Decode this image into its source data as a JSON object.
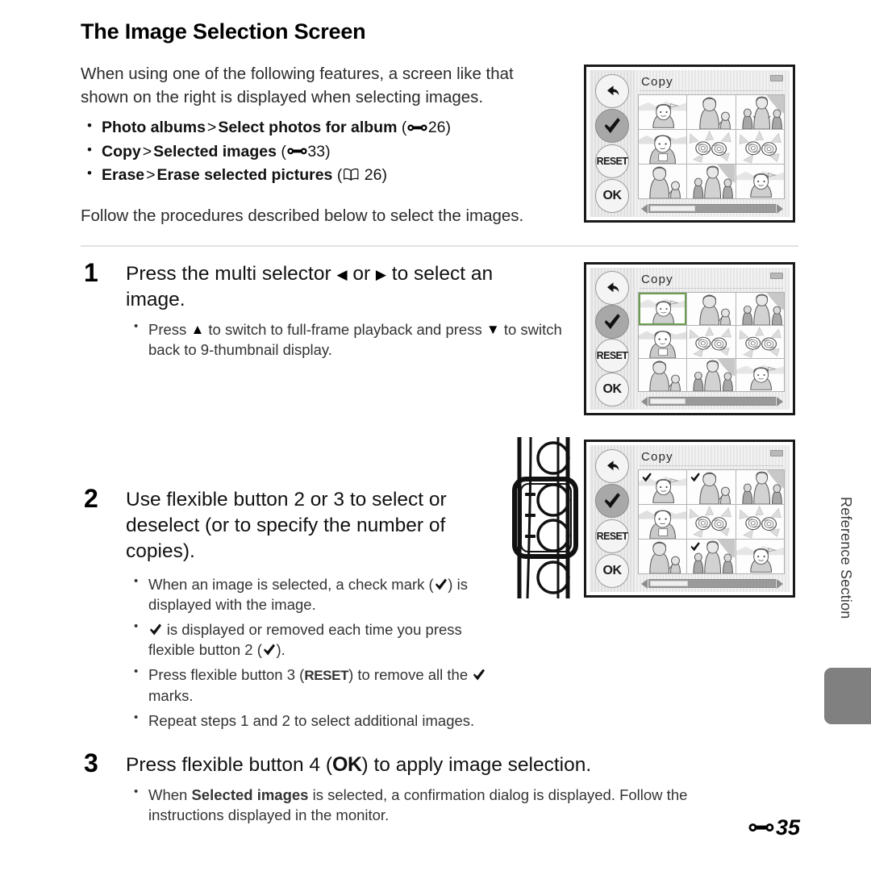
{
  "page": {
    "heading": "The Image Selection Screen",
    "intro": "When using one of the following features, a screen like that shown on the right is displayed when selecting images.",
    "follow_text": "Follow the procedures described below to select the images.",
    "footer_page": "35"
  },
  "feature_list": [
    {
      "item": "Photo albums",
      "sep": ">",
      "sub": "Select photos for album",
      "ref_icon": "e-icon",
      "ref_page": "26"
    },
    {
      "item": "Copy",
      "sep": ">",
      "sub": "Selected images",
      "ref_icon": "e-icon",
      "ref_page": "33"
    },
    {
      "item": "Erase",
      "sep": ">",
      "sub": "Erase selected pictures",
      "ref_icon": "book-icon",
      "ref_page": "26"
    }
  ],
  "steps": [
    {
      "number": "1",
      "title_a": "Press the multi selector ",
      "title_b": " or ",
      "title_c": " to select an image.",
      "bullets": [
        {
          "a": "Press ",
          "b": " to switch to full-frame playback and press ",
          "c": " to switch back to 9-thumbnail display."
        }
      ]
    },
    {
      "number": "2",
      "title": "Use flexible button 2 or 3 to select or deselect (or to specify the number of copies).",
      "bullets": [
        {
          "a": "When an image is selected, a check mark (",
          "b": ") is displayed with the image."
        },
        {
          "a": "",
          "b": " is displayed or removed each time you press flexible button 2 (",
          "c": ")."
        },
        {
          "a": "Press flexible button 3 (",
          "label": "RESET",
          "b": ") to remove all the ",
          "c": " marks."
        },
        {
          "a": "Repeat steps 1 and 2 to select additional images."
        }
      ]
    },
    {
      "number": "3",
      "title_a": "Press flexible button 4 (",
      "title_ok": "OK",
      "title_b": ") to apply image selection.",
      "bullets": [
        {
          "a": "When ",
          "bold": "Selected images",
          "b": " is selected, a confirmation dialog is displayed. Follow the instructions displayed in the monitor."
        }
      ]
    }
  ],
  "lcd_screens": [
    {
      "id": "screen-1",
      "title": "Copy",
      "buttons": [
        {
          "name": "back-button",
          "glyph": "back-arrow",
          "state": "normal"
        },
        {
          "name": "check-button",
          "glyph": "check",
          "state": "highlighted"
        },
        {
          "name": "reset-button",
          "glyph": "RESET",
          "state": "normal"
        },
        {
          "name": "ok-button",
          "glyph": "OK",
          "state": "normal"
        }
      ],
      "thumbnails": [
        {
          "art": "woman-landscape",
          "selected": false,
          "checked": false
        },
        {
          "art": "woman-child",
          "selected": false,
          "checked": false
        },
        {
          "art": "family-three",
          "selected": false,
          "checked": false
        },
        {
          "art": "woman-portrait",
          "selected": false,
          "checked": false
        },
        {
          "art": "flowers",
          "selected": false,
          "checked": false
        },
        {
          "art": "flowers",
          "selected": false,
          "checked": false
        },
        {
          "art": "woman-child",
          "selected": false,
          "checked": false
        },
        {
          "art": "family-three",
          "selected": false,
          "checked": false
        },
        {
          "art": "woman-landscape",
          "selected": false,
          "checked": false
        }
      ],
      "scrollbar_thumb_pct": 36
    },
    {
      "id": "screen-2",
      "title": "Copy",
      "buttons": [
        {
          "name": "back-button",
          "glyph": "back-arrow",
          "state": "normal"
        },
        {
          "name": "check-button",
          "glyph": "check",
          "state": "highlighted"
        },
        {
          "name": "reset-button",
          "glyph": "RESET",
          "state": "normal"
        },
        {
          "name": "ok-button",
          "glyph": "OK",
          "state": "normal"
        }
      ],
      "thumbnails": [
        {
          "art": "woman-landscape",
          "selected": true,
          "checked": false
        },
        {
          "art": "woman-child",
          "selected": false,
          "checked": false
        },
        {
          "art": "family-three",
          "selected": false,
          "checked": false
        },
        {
          "art": "woman-portrait",
          "selected": false,
          "checked": false
        },
        {
          "art": "flowers",
          "selected": false,
          "checked": false
        },
        {
          "art": "flowers",
          "selected": false,
          "checked": false
        },
        {
          "art": "woman-child",
          "selected": false,
          "checked": false
        },
        {
          "art": "family-three",
          "selected": false,
          "checked": false
        },
        {
          "art": "woman-landscape",
          "selected": false,
          "checked": false
        }
      ],
      "scrollbar_thumb_pct": 28
    },
    {
      "id": "screen-3",
      "title": "Copy",
      "buttons": [
        {
          "name": "back-button",
          "glyph": "back-arrow",
          "state": "normal"
        },
        {
          "name": "check-button",
          "glyph": "check",
          "state": "highlighted"
        },
        {
          "name": "reset-button",
          "glyph": "RESET",
          "state": "normal"
        },
        {
          "name": "ok-button",
          "glyph": "OK",
          "state": "normal"
        }
      ],
      "thumbnails": [
        {
          "art": "woman-landscape",
          "selected": false,
          "checked": true
        },
        {
          "art": "woman-child",
          "selected": false,
          "checked": true
        },
        {
          "art": "family-three",
          "selected": false,
          "checked": false
        },
        {
          "art": "woman-portrait",
          "selected": false,
          "checked": false
        },
        {
          "art": "flowers",
          "selected": false,
          "checked": false
        },
        {
          "art": "flowers",
          "selected": false,
          "checked": false
        },
        {
          "art": "woman-child",
          "selected": false,
          "checked": false
        },
        {
          "art": "family-three",
          "selected": false,
          "checked": true
        },
        {
          "art": "woman-landscape",
          "selected": false,
          "checked": false
        }
      ],
      "scrollbar_thumb_pct": 30
    }
  ],
  "side_tab": {
    "label": "Reference Section"
  }
}
